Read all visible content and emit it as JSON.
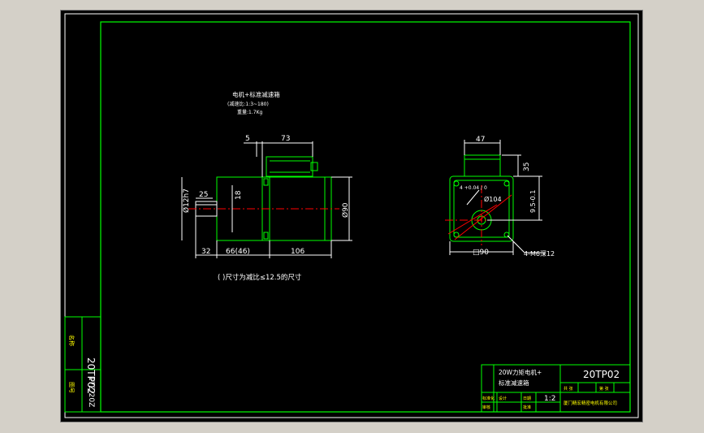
{
  "drawing": {
    "title_cn": "电机+标准减速箱",
    "ratio_line": "(减速比:1:3~180)",
    "weight_line": "重量:1.7Kg",
    "note": "( )尺寸为减比≤12.5的尺寸",
    "front_view": {
      "dim_top_5": "5",
      "dim_top_73": "73",
      "dim_shaft_dia": "Ø12h7",
      "dim_25": "25",
      "dim_18": "18",
      "dim_90": "Ø90",
      "dim_32": "32",
      "dim_66": "66(46)",
      "dim_106": "106"
    },
    "side_view": {
      "dim_47": "47",
      "dim_35": "35",
      "dim_tol": "4 +0.04 / 0",
      "dim_phi104": "Ø104",
      "dim_95": "9.5-0.1",
      "dim_square": "□90",
      "dim_holes": "4-M6深12"
    }
  },
  "left_strip": {
    "code": "20TP02",
    "fraction": "17Z/20Z",
    "label_a": "名称",
    "label_b": "图号"
  },
  "title_block": {
    "product_name_1": "20W力矩电机+",
    "product_name_2": "标准减速箱",
    "drawing_number": "20TP02",
    "scale": "1:2",
    "company": "厦门精宏精密电机有限公司",
    "cells": [
      "设计",
      "标准化",
      "日期",
      "审核",
      "批准",
      "共 张",
      "第 张"
    ]
  },
  "colors": {
    "frame": "#00ff00",
    "lines": "#ffffff",
    "centerline": "#ff0000",
    "background": "#000000"
  }
}
